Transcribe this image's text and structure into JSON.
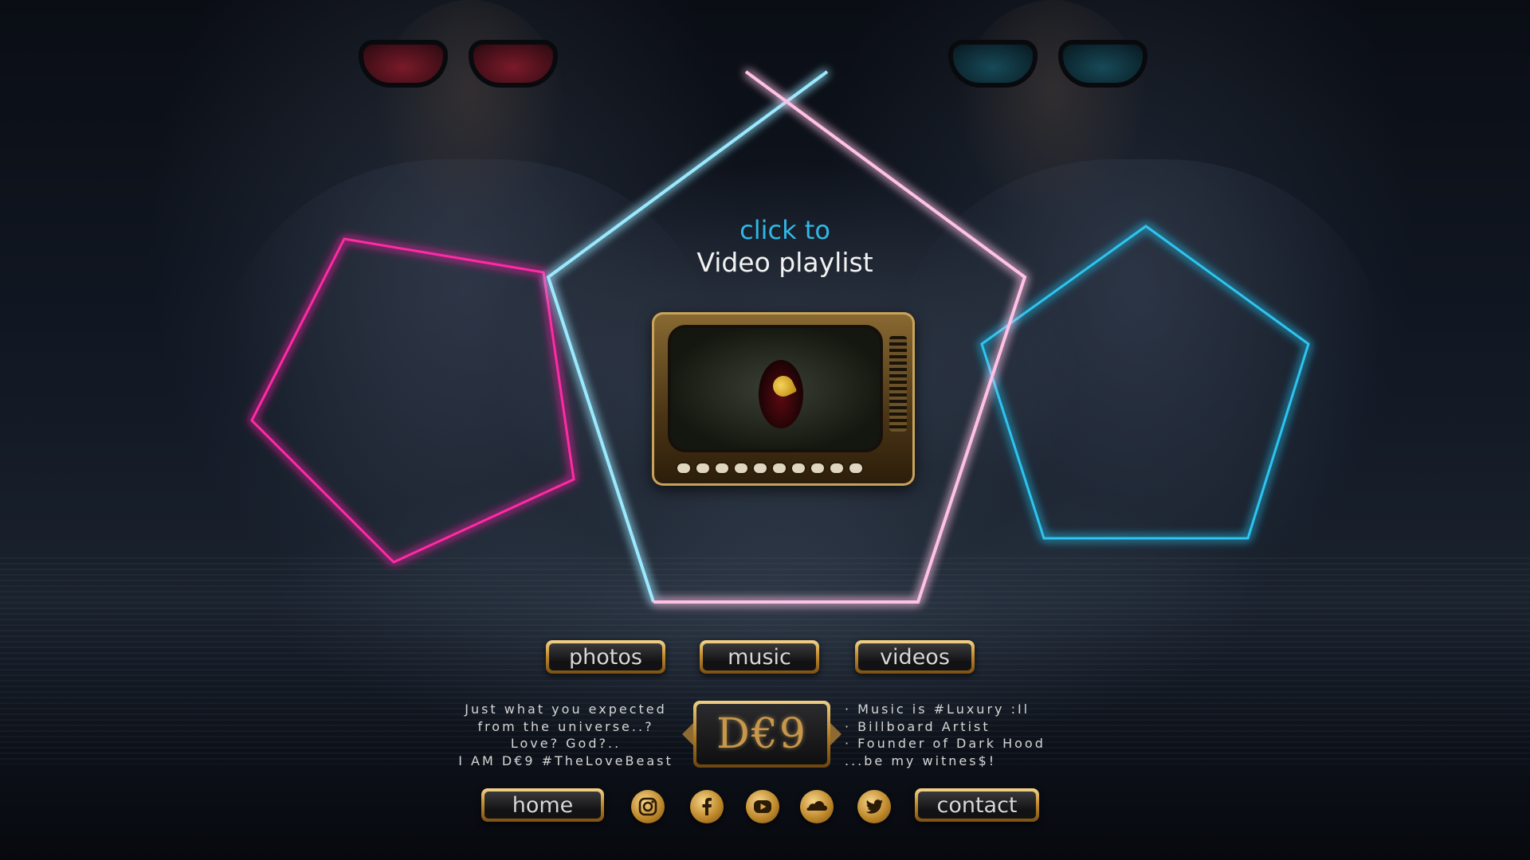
{
  "hero": {
    "click_to": "click to",
    "title": "Video playlist"
  },
  "nav": {
    "photos": "photos",
    "music": "music",
    "videos": "videos"
  },
  "tagline_left": [
    "Just what you expected",
    "from the universe..?",
    "Love? God?..",
    "I AM D€9 #TheLoveBeast"
  ],
  "tagline_right": [
    "· Music is #Luxury :Il",
    "· Billboard Artist",
    "· Founder of Dark Hood",
    "...be my witnes$!"
  ],
  "logo": {
    "text": "D€9"
  },
  "footer": {
    "home": "home",
    "contact": "contact"
  },
  "social_icons": [
    "instagram-icon",
    "facebook-icon",
    "youtube-icon",
    "soundcloud-icon",
    "twitter-icon"
  ],
  "colors": {
    "neon_pink": "#ff2aa6",
    "neon_cyan": "#2fc4f0",
    "gold": "#c58d2e",
    "accent_blue_text": "#2fb8e6"
  }
}
